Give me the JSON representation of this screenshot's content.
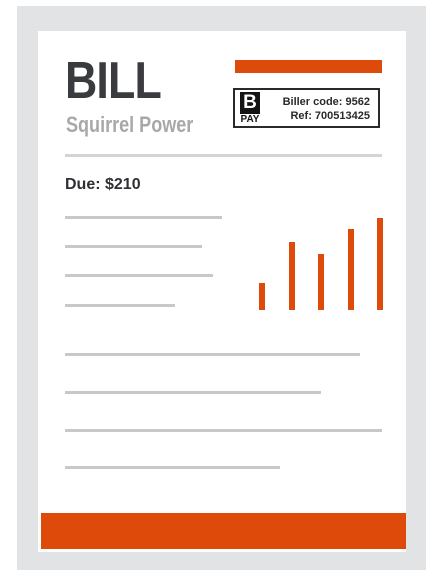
{
  "bill": {
    "title": "BILL",
    "company": "Squirrel Power",
    "due": "Due: $210"
  },
  "bpay": {
    "logo_mark": "B",
    "logo_word": "PAY",
    "biller_code": "Biller code: 9562",
    "ref": "Ref: 700513425"
  },
  "chart_data": {
    "type": "bar",
    "values": [
      27,
      68,
      56,
      81,
      92
    ],
    "ylim": [
      0,
      100
    ]
  },
  "colors": {
    "accent": "#dd4a0a",
    "frame": "#e2e3e4",
    "placeholder_line": "#c7c8ca",
    "title_text": "#3a3b3f",
    "subtitle_text": "#a7a8aa"
  },
  "icons": {
    "bpay": "bpay-logo-icon"
  }
}
